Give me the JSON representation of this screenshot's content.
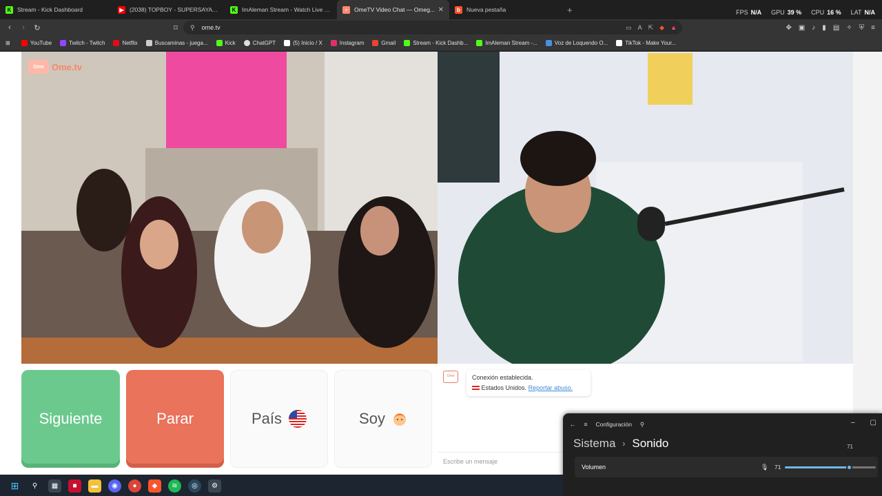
{
  "tabs": [
    {
      "title": "Stream - Kick Dashboard",
      "active": false,
      "icon": "kick-icon"
    },
    {
      "title": "(2038) TOPBOY - SUPERSAYAYIN (Vi...",
      "active": false,
      "icon": "youtube-icon"
    },
    {
      "title": "ImAleman Stream - Watch Live o...",
      "active": false,
      "icon": "kick-icon"
    },
    {
      "title": "OmeTV Video Chat — Omeg...",
      "active": true,
      "icon": "ometv-icon"
    },
    {
      "title": "Nueva pestaña",
      "active": false,
      "icon": "brave-icon"
    }
  ],
  "stats": {
    "fps_label": "FPS",
    "fps": "N/A",
    "gpu_label": "GPU",
    "gpu": "39 %",
    "cpu_label": "CPU",
    "cpu": "16 %",
    "lat_label": "LAT",
    "lat": "N/A"
  },
  "address": {
    "url": "ome.tv"
  },
  "bookmarks": [
    {
      "label": "YouTube",
      "color": "#ff0000"
    },
    {
      "label": "Twitch - Twitch",
      "color": "#9146ff"
    },
    {
      "label": "Netflix",
      "color": "#e50914"
    },
    {
      "label": "Buscaminas - juega...",
      "color": "#cccccc"
    },
    {
      "label": "Kick",
      "color": "#53fc18"
    },
    {
      "label": "ChatGPT",
      "color": "#dddddd"
    },
    {
      "label": "(5) Inicio / X",
      "color": "#ffffff"
    },
    {
      "label": "Instagram",
      "color": "#e1306c"
    },
    {
      "label": "Gmail",
      "color": "#ea4335"
    },
    {
      "label": "Stream - Kick Dashb...",
      "color": "#53fc18"
    },
    {
      "label": "ImAleman Stream -...",
      "color": "#53fc18"
    },
    {
      "label": "Voz de Loquendo O...",
      "color": "#4a90e2"
    },
    {
      "label": "TikTok - Make Your...",
      "color": "#ffffff"
    }
  ],
  "ometv": {
    "logo_text": "Ome.tv",
    "buttons": {
      "next": "Siguiente",
      "stop": "Parar",
      "country": "País",
      "gender": "Soy"
    },
    "chat": {
      "connection_text": "Conexión establecida.",
      "country_text": "Estados Unidos.",
      "report_link": "Reportar abuso.",
      "input_placeholder": "Escribe un mensaje"
    },
    "colors": {
      "next": "#6cc98e",
      "stop": "#e9735b",
      "accent": "#e47a5f"
    }
  },
  "settings": {
    "window_title": "Configuración",
    "breadcrumb_root": "Sistema",
    "breadcrumb_page": "Sonido",
    "volume_label": "Volumen",
    "volume_value": "71",
    "volume_badge": "71",
    "volume_fraction": 0.71
  },
  "taskbar": {
    "apps": [
      "windows-start-icon",
      "search-icon",
      "store-icon",
      "app-icon",
      "file-explorer-icon",
      "discord-icon",
      "chrome-icon",
      "brave-icon",
      "spotify-icon",
      "steam-icon",
      "settings-icon"
    ]
  }
}
